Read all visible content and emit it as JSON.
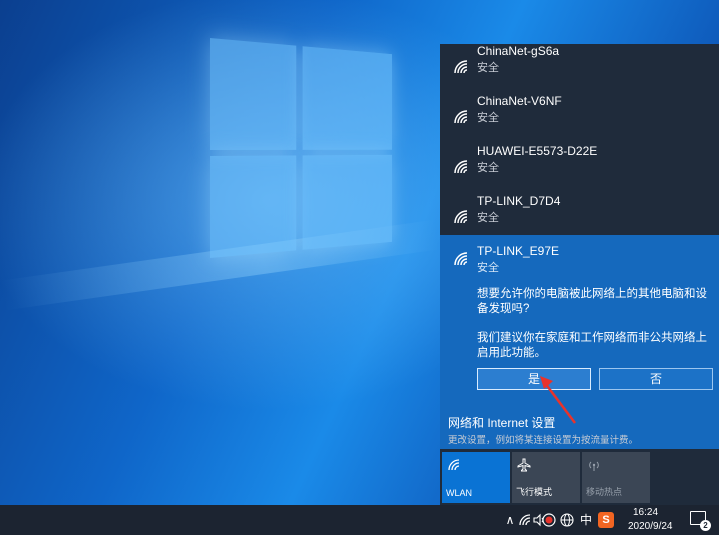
{
  "networks": [
    {
      "name": "ChinaNet-gS6a",
      "status": "安全"
    },
    {
      "name": "ChinaNet-V6NF",
      "status": "安全"
    },
    {
      "name": "HUAWEI-E5573-D22E",
      "status": "安全"
    },
    {
      "name": "TP-LINK_D7D4",
      "status": "安全"
    }
  ],
  "selected": {
    "name": "TP-LINK_E97E",
    "status": "安全",
    "question": "想要允许你的电脑被此网络上的其他电脑和设备发现吗?",
    "suggestion": "我们建议你在家庭和工作网络而非公共网络上启用此功能。",
    "yes_label": "是",
    "no_label": "否"
  },
  "settings": {
    "title": "网络和 Internet 设置",
    "subtitle": "更改设置，例如将某连接设置为按流量计费。"
  },
  "quick_actions": [
    {
      "label": "WLAN",
      "icon": "wifi-icon",
      "active": true
    },
    {
      "label": "飞行模式",
      "icon": "airplane-icon",
      "active": false
    },
    {
      "label": "移动热点",
      "icon": "hotspot-icon",
      "active": false
    }
  ],
  "taskbar": {
    "chevron": "∧",
    "ime": "中",
    "sogou": "S",
    "time": "16:24",
    "date": "2020/9/24",
    "notification_count": "2"
  },
  "colors": {
    "flyout_bg": "#1f2b3b",
    "selected_bg": "#1569bd",
    "accent": "#0a73d4",
    "cursor_arrow": "#e8332b"
  }
}
